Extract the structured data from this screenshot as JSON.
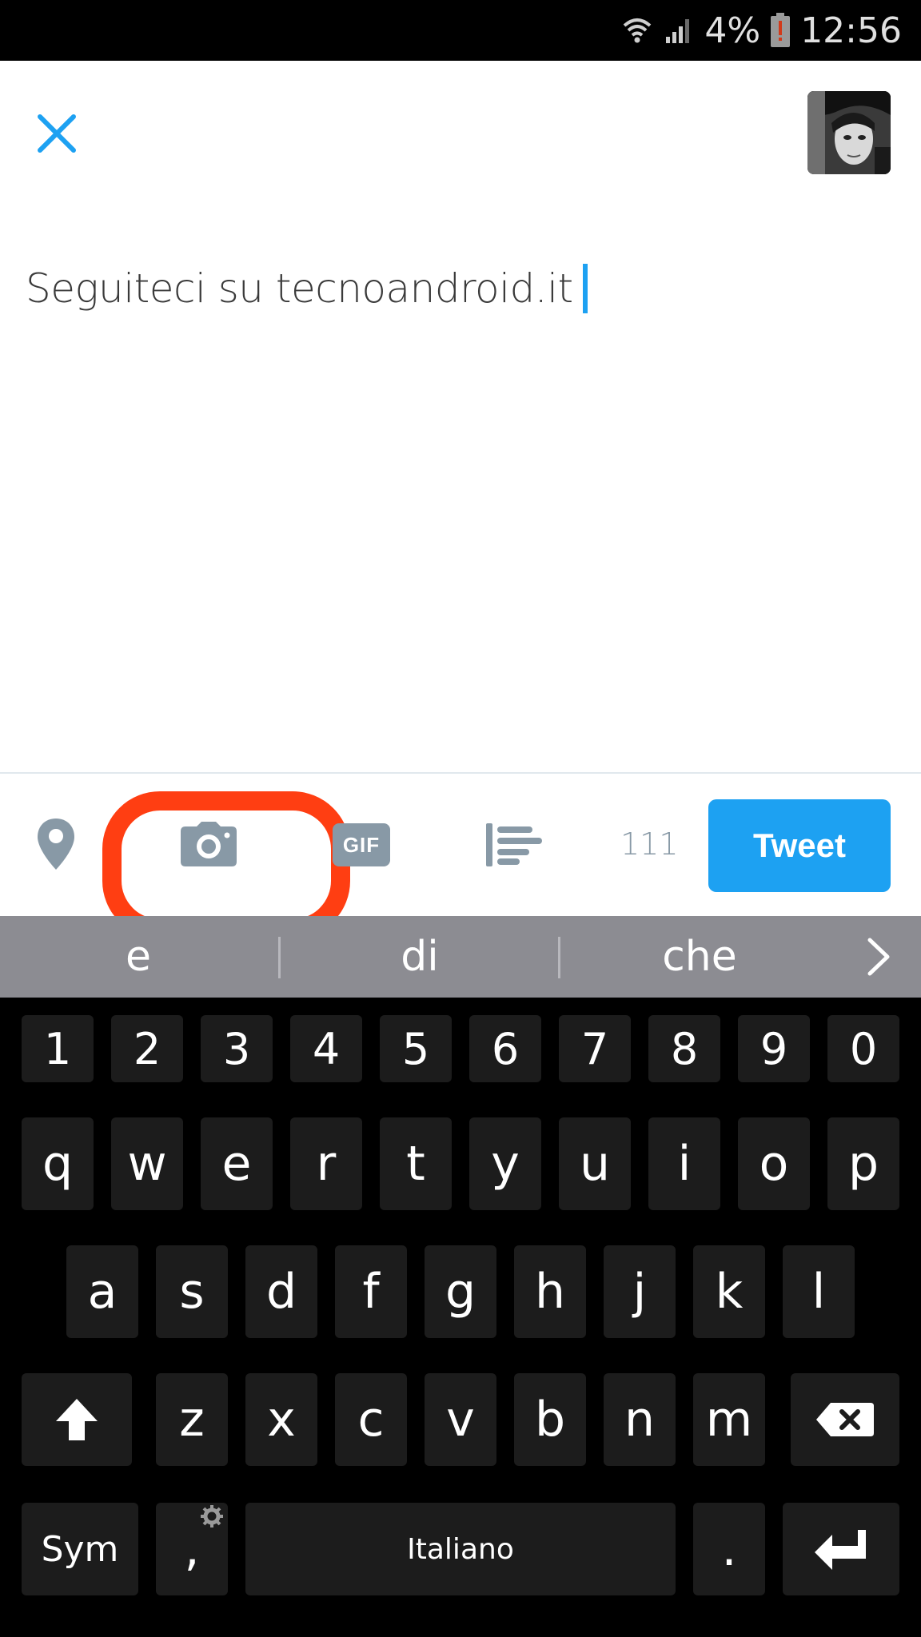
{
  "status_bar": {
    "battery_percent": "4%",
    "time": "12:56",
    "icons": [
      "wifi-icon",
      "signal-icon",
      "battery-low-icon"
    ]
  },
  "compose": {
    "close_icon": "close-icon",
    "avatar": "user-avatar",
    "text": "Seguiteci su tecnoandroid.it"
  },
  "toolbar": {
    "icons": [
      "location-icon",
      "camera-icon",
      "gif-icon",
      "poll-icon"
    ],
    "gif_label": "GIF",
    "char_count": "111",
    "tweet_label": "Tweet",
    "highlight_color": "#ff3e12",
    "accent_color": "#1da1f2"
  },
  "suggestions": {
    "words": [
      "e",
      "di",
      "che"
    ],
    "more_icon": "chevron-right-icon"
  },
  "keyboard": {
    "numbers": [
      "1",
      "2",
      "3",
      "4",
      "5",
      "6",
      "7",
      "8",
      "9",
      "0"
    ],
    "row1": [
      "q",
      "w",
      "e",
      "r",
      "t",
      "y",
      "u",
      "i",
      "o",
      "p"
    ],
    "row2": [
      "a",
      "s",
      "d",
      "f",
      "g",
      "h",
      "j",
      "k",
      "l"
    ],
    "row3": [
      "z",
      "x",
      "c",
      "v",
      "b",
      "n",
      "m"
    ],
    "sym_label": "Sym",
    "comma": ",",
    "space_label": "Italiano",
    "period": ".",
    "shift_icon": "shift-icon",
    "backspace_icon": "backspace-icon",
    "enter_icon": "enter-icon",
    "settings_icon": "gear-icon"
  }
}
